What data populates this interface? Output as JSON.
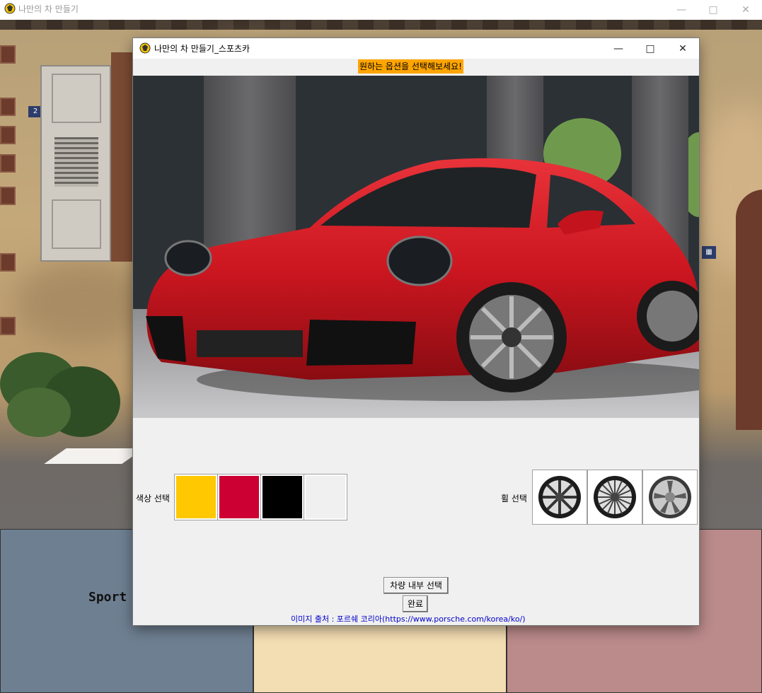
{
  "outer_window": {
    "title": "나만의 차 만들기",
    "controls": [
      "minimize-icon",
      "maximize-icon",
      "close-icon"
    ],
    "bottom_panels": [
      {
        "label": "Sport",
        "color": "#6e7f91"
      },
      {
        "color": "#f3ddb2"
      },
      {
        "color": "#bb8a8a"
      }
    ],
    "house_number": "2"
  },
  "inner_window": {
    "title": "나만의 차 만들기_스포츠카",
    "prompt": "원하는 옵션을 선택해보세요!",
    "prompt_color": "#ffa500",
    "car_image": {
      "subject": "red Porsche 911 sports car",
      "icon": "car-photo"
    },
    "color_section": {
      "label": "색상 선택",
      "swatches": [
        {
          "name": "yellow",
          "color": "#ffc800"
        },
        {
          "name": "red",
          "color": "#cc0033"
        },
        {
          "name": "black",
          "color": "#000000"
        },
        {
          "name": "white",
          "color": "#f0f0f0"
        }
      ]
    },
    "wheel_section": {
      "label": "휠 선택",
      "wheels": [
        {
          "name": "wheel-option-1",
          "icon": "wheel-icon"
        },
        {
          "name": "wheel-option-2",
          "icon": "wheel-icon"
        },
        {
          "name": "wheel-option-3",
          "icon": "wheel-icon"
        }
      ]
    },
    "buttons": {
      "interior": "차량 내부 선택",
      "done": "완료"
    },
    "source": "이미지 출처 : 포르쉐 코리아(https://www.porsche.com/korea/ko/)",
    "source_color": "#0000cc"
  }
}
